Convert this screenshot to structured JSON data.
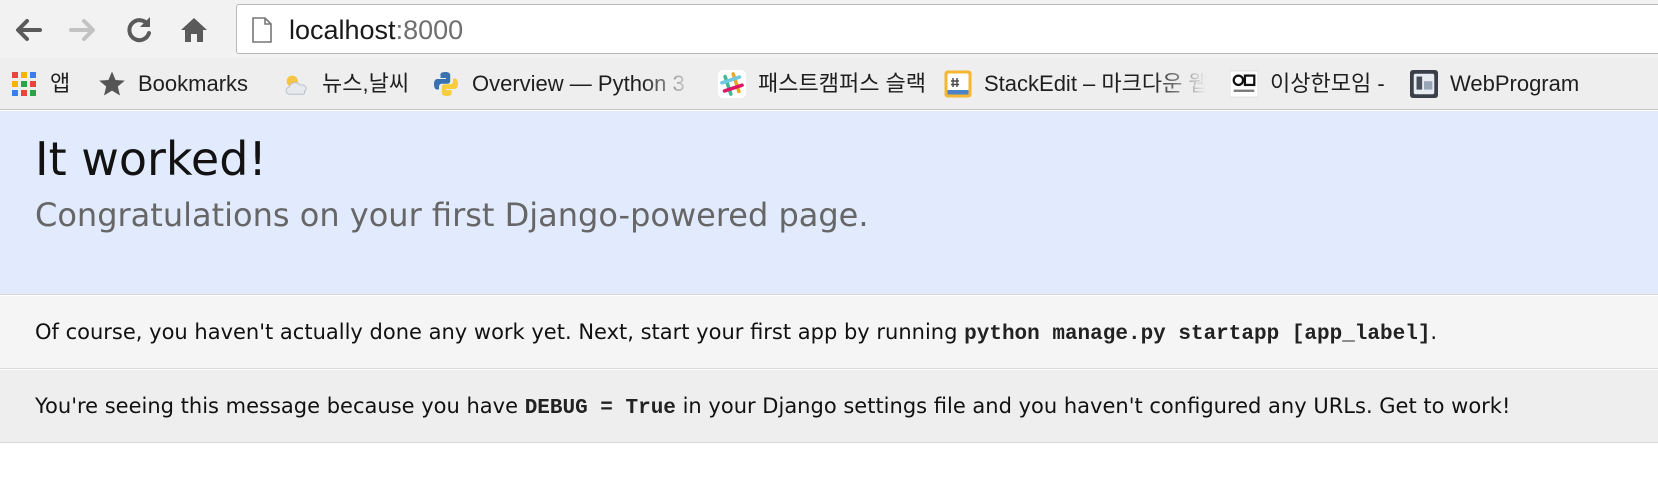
{
  "browser": {
    "url_host": "localhost",
    "url_port": ":8000",
    "bookmarks": [
      {
        "icon": "apps-grid-icon",
        "label": "앱"
      },
      {
        "icon": "star-icon",
        "label": "Bookmarks"
      },
      {
        "icon": "weather-icon",
        "label": "뉴스,날씨"
      },
      {
        "icon": "python-logo-icon",
        "label": "Overview — Python 3"
      },
      {
        "icon": "slack-logo-icon",
        "label": "패스트캠퍼스 슬랙"
      },
      {
        "icon": "stackedit-logo-icon",
        "label": "StackEdit – 마크다운 웹"
      },
      {
        "icon": "site-logo-icon",
        "label": "이상한모임 -"
      },
      {
        "icon": "site-thumbnail-icon",
        "label": "WebProgram"
      }
    ]
  },
  "page": {
    "title": "It worked!",
    "subtitle": "Congratulations on your first Django-powered page.",
    "instructions": {
      "before": "Of course, you haven't actually done any work yet. Next, start your first app by running ",
      "code": "python manage.py startapp [app_label]",
      "after": "."
    },
    "explanation": {
      "before": "You're seeing this message because you have ",
      "code": "DEBUG = True",
      "after": " in your Django settings file and you haven't configured any URLs. Get to work!"
    }
  }
}
